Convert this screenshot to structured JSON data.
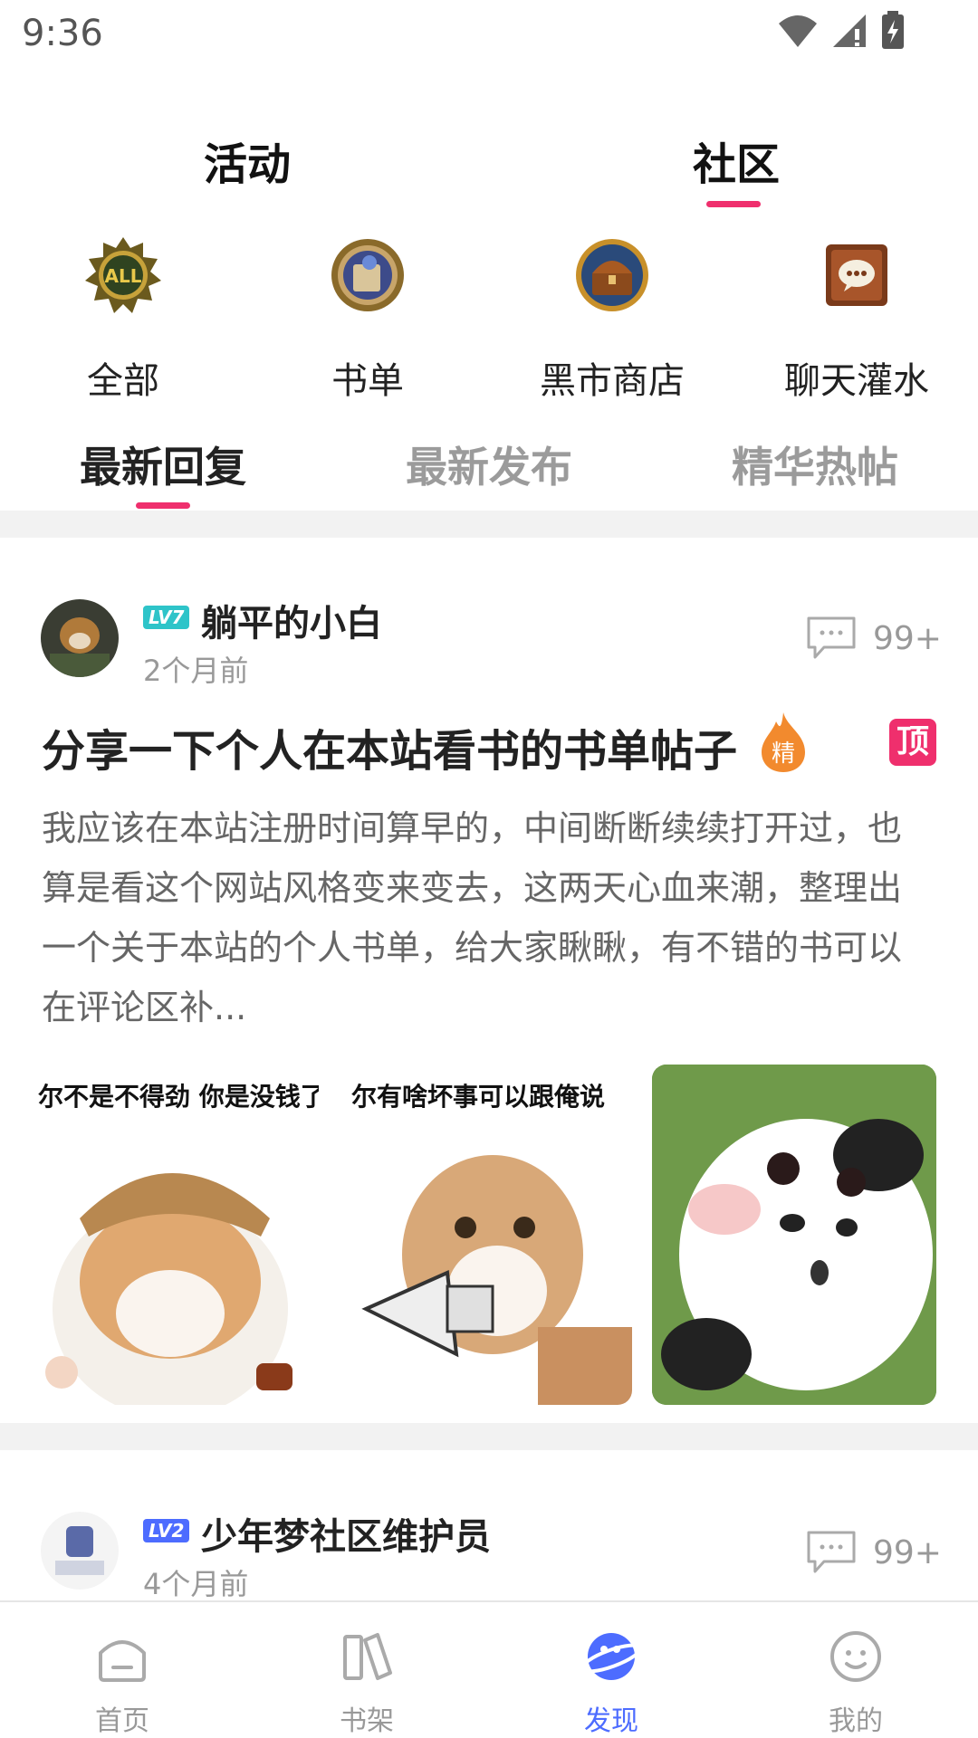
{
  "status_bar": {
    "time": "9:36"
  },
  "top_tabs": {
    "activity": "活动",
    "community": "社区"
  },
  "categories": [
    {
      "label": "全部",
      "icon": "all-badge-icon",
      "badge_text": "ALL"
    },
    {
      "label": "书单",
      "icon": "book-list-icon"
    },
    {
      "label": "黑市商店",
      "icon": "treasure-chest-icon"
    },
    {
      "label": "聊天灌水",
      "icon": "chat-icon"
    }
  ],
  "sub_tabs": [
    "最新回复",
    "最新发布",
    "精华热帖"
  ],
  "posts": [
    {
      "level": "LV7",
      "username": "躺平的小白",
      "time": "2个月前",
      "comment_count": "99+",
      "title": "分享一下个人在本站看书的书单帖子",
      "hot_badge": "精",
      "pin_badge": "顶",
      "excerpt": "我应该在本站注册时间算早的，中间断断续续打开过，也算是看这个网站风格变来变去，这两天心血来潮，整理出一个关于本站的个人书单，给大家瞅瞅，有不错的书可以在评论区补...",
      "images": [
        {
          "caption": "尔不是不得劲 你是没钱了"
        },
        {
          "caption": "尔有啥坏事可以跟俺说"
        },
        {
          "caption": ""
        }
      ]
    },
    {
      "level": "LV2",
      "username": "少年梦社区维护员",
      "time": "4个月前",
      "comment_count": "99+"
    }
  ],
  "bottom_nav": [
    {
      "label": "首页",
      "icon": "home-icon"
    },
    {
      "label": "书架",
      "icon": "bookshelf-icon"
    },
    {
      "label": "发现",
      "icon": "discover-planet-icon",
      "active": true
    },
    {
      "label": "我的",
      "icon": "profile-smile-icon"
    }
  ],
  "colors": {
    "accent": "#ef2f6d",
    "nav_active": "#4d6cff"
  }
}
